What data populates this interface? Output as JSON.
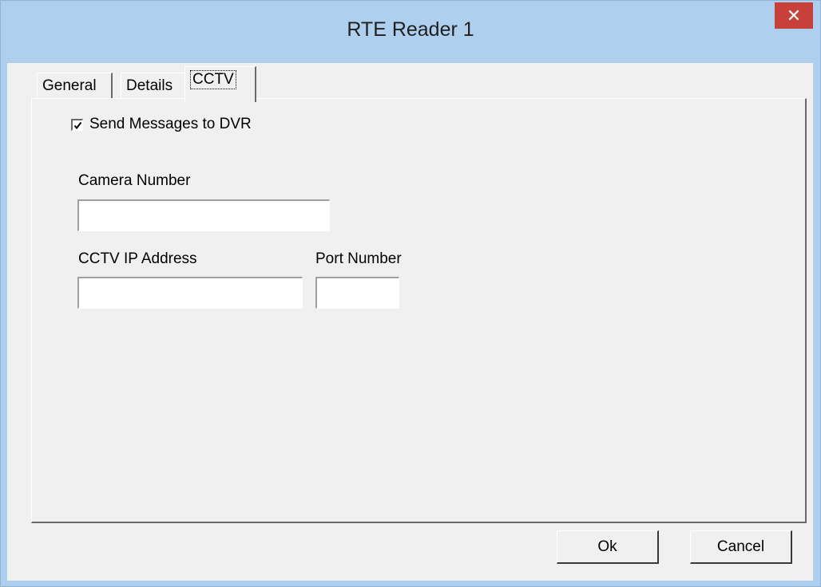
{
  "window": {
    "title": "RTE Reader 1",
    "close_symbol": "✕"
  },
  "tabs": [
    {
      "label": "General",
      "active": false
    },
    {
      "label": "Details",
      "active": false
    },
    {
      "label": "CCTV",
      "active": true
    }
  ],
  "cctv": {
    "send_messages": {
      "label": "Send Messages to DVR",
      "checked": true
    },
    "camera_number": {
      "label": "Camera Number",
      "value": ""
    },
    "ip_address": {
      "label": "CCTV IP Address",
      "value": ""
    },
    "port_number": {
      "label": "Port Number",
      "value": ""
    }
  },
  "buttons": {
    "ok": "Ok",
    "cancel": "Cancel"
  },
  "colors": {
    "titlebar": "#aed0ee",
    "close": "#c7413a",
    "face": "#f0f0f0"
  }
}
